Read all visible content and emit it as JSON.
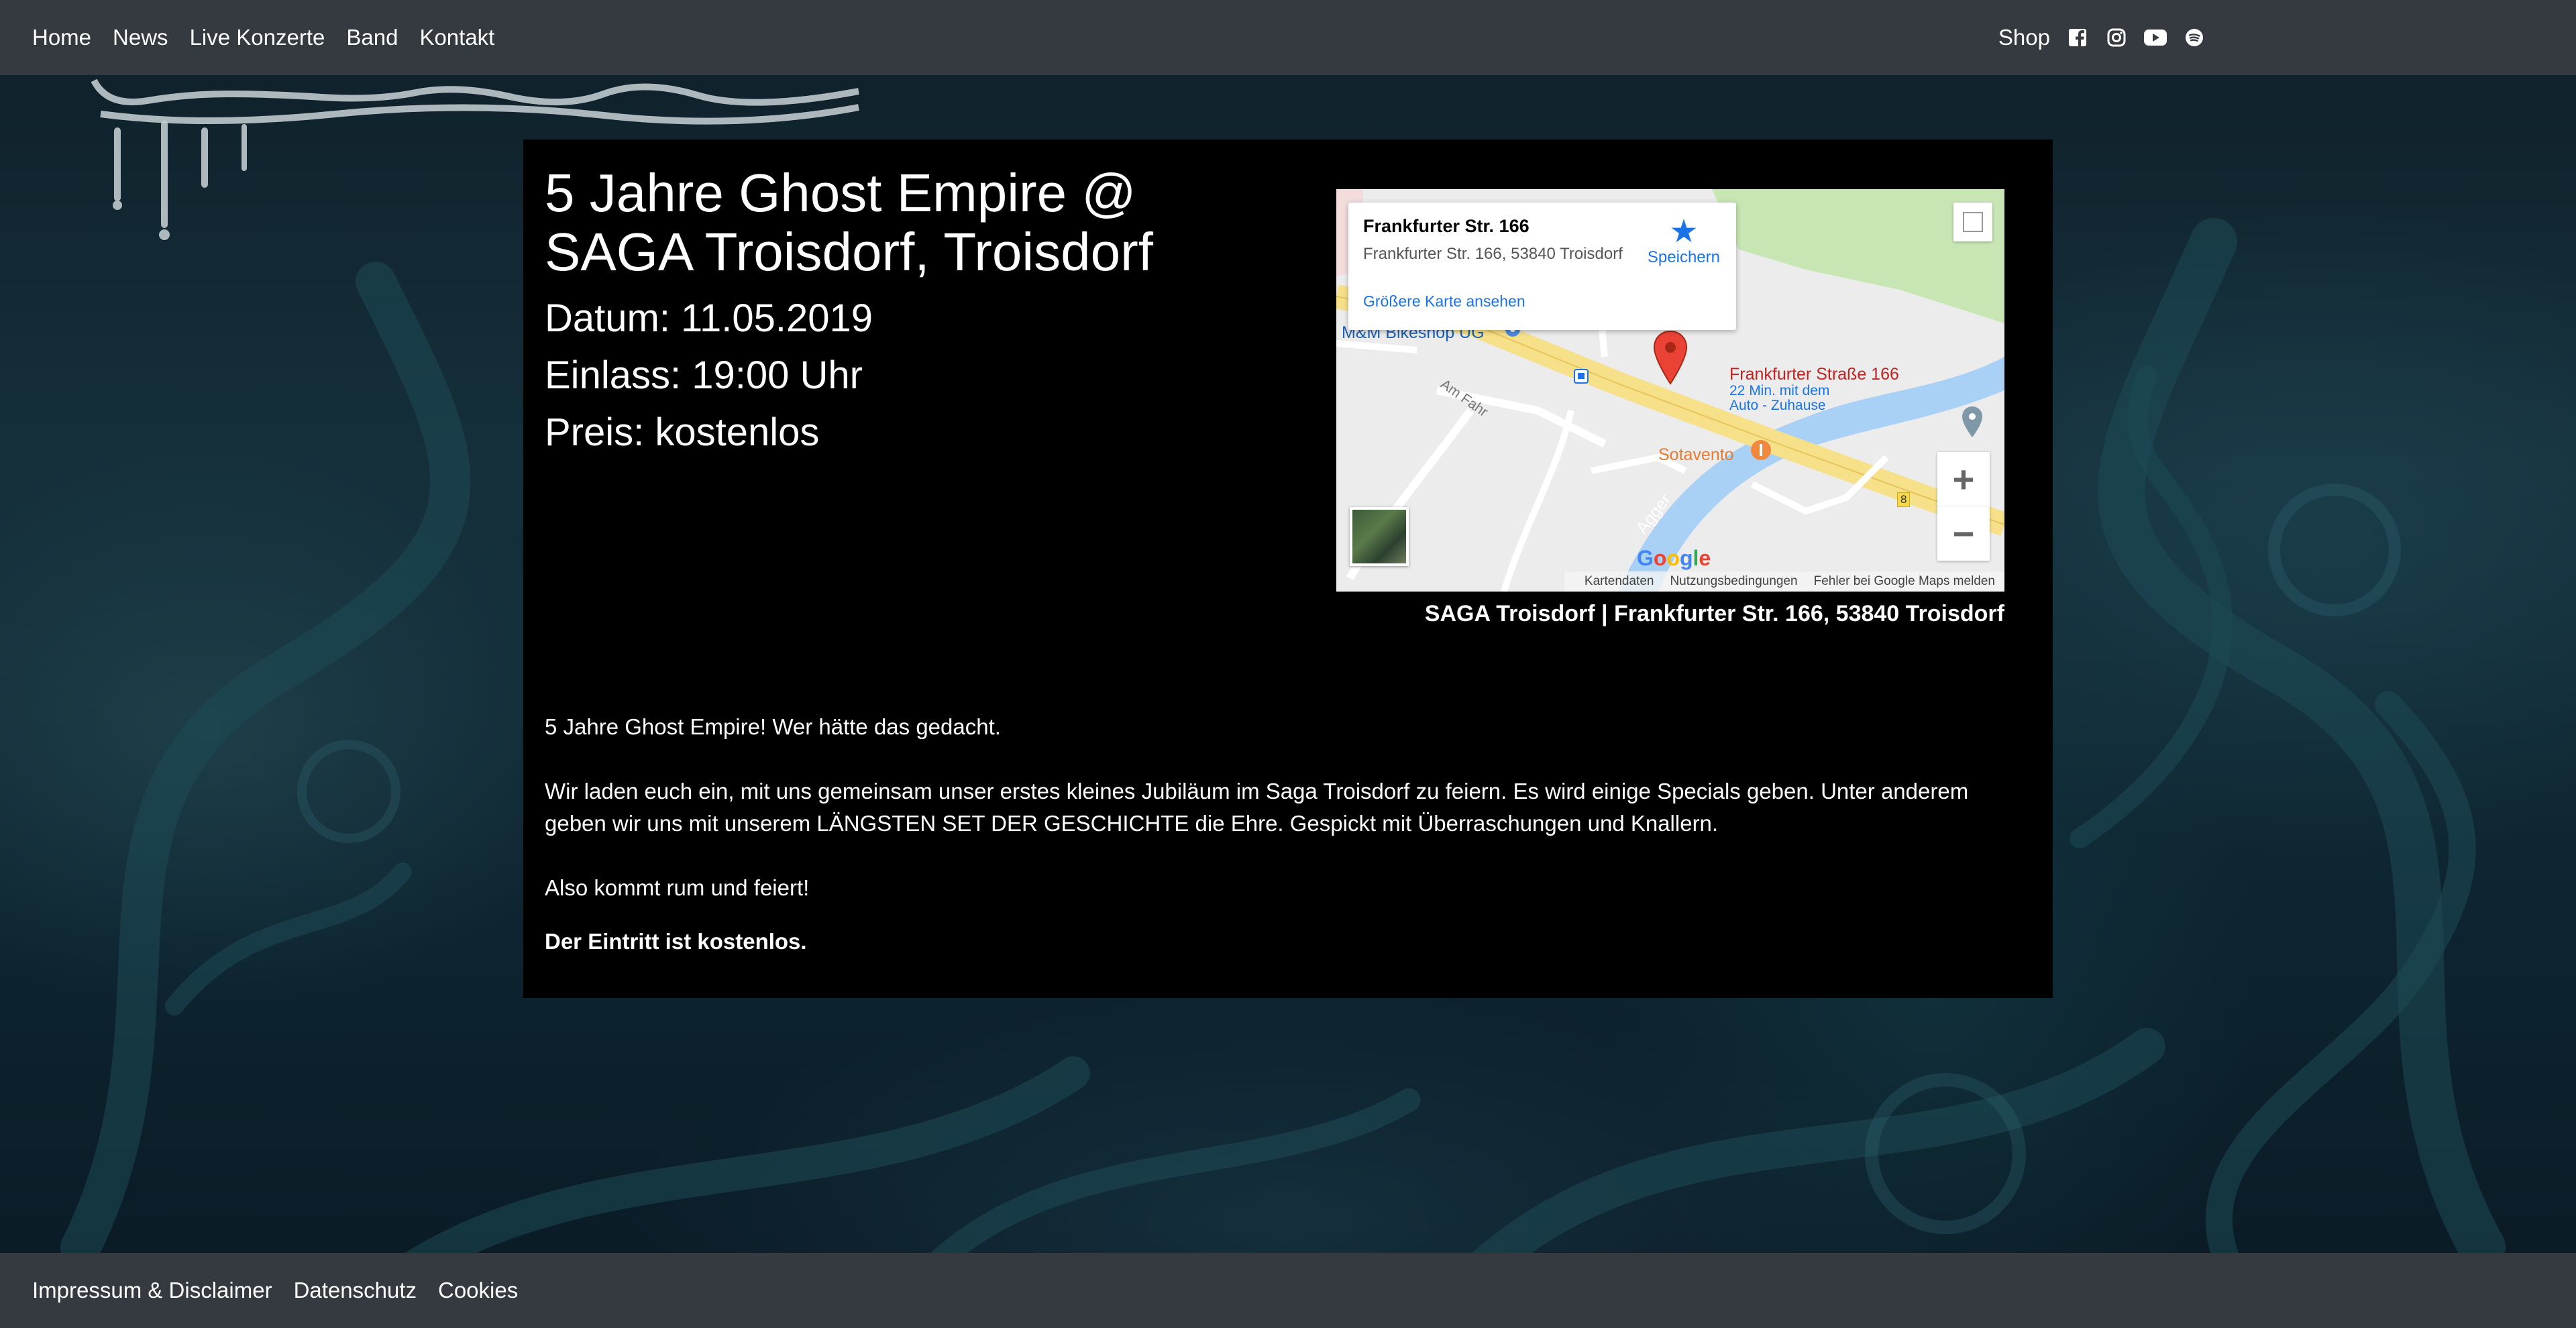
{
  "nav": {
    "items": [
      "Home",
      "News",
      "Live Konzerte",
      "Band",
      "Kontakt"
    ],
    "shop": "Shop",
    "icons": [
      "facebook-icon",
      "instagram-icon",
      "youtube-icon",
      "spotify-icon"
    ]
  },
  "event": {
    "title": "5 Jahre Ghost Empire @ SAGA Troisdorf, Troisdorf",
    "date": "Datum: 11.05.2019",
    "entry": "Einlass: 19:00 Uhr",
    "price": "Preis: kostenlos"
  },
  "map": {
    "popup_name": "Frankfurter Str. 166",
    "popup_address": "Frankfurter Str. 166, 53840 Troisdorf",
    "popup_save": "Speichern",
    "popup_link": "Größere Karte ansehen",
    "pin_label": "Frankfurter Straße 166",
    "pin_sub1": "22 Min. mit dem",
    "pin_sub2": "Auto - Zuhause",
    "poi_bikeshop": "M&M Bikeshop UG",
    "poi_restaurant": "Sotavento",
    "street_am_fahr": "Am Fahr",
    "river_agger": "Agger",
    "road_number": "8",
    "google": "Google",
    "footer_data": "Kartendaten",
    "footer_terms": "Nutzungsbedingungen",
    "footer_report": "Fehler bei Google Maps melden",
    "caption": "SAGA Troisdorf | Frankfurter Str. 166, 53840 Troisdorf"
  },
  "body": {
    "p1": "5 Jahre Ghost Empire! Wer hätte das gedacht.",
    "p2": "Wir laden euch ein, mit uns gemeinsam unser erstes kleines Jubiläum im Saga Troisdorf zu feiern. Es wird einige Specials geben. Unter anderem geben wir uns mit unserem LÄNGSTEN SET DER GESCHICHTE die Ehre. Gespickt mit Überraschungen und Knallern.",
    "p3": "Also kommt rum und feiert!",
    "p4": "Der Eintritt ist kostenlos."
  },
  "footer": {
    "items": [
      "Impressum & Disclaimer",
      "Datenschutz",
      "Cookies"
    ]
  },
  "colors": {
    "navbar": "#343a40",
    "card": "#000000",
    "link_blue": "#1a73e8",
    "pin_red": "#ea4335"
  }
}
